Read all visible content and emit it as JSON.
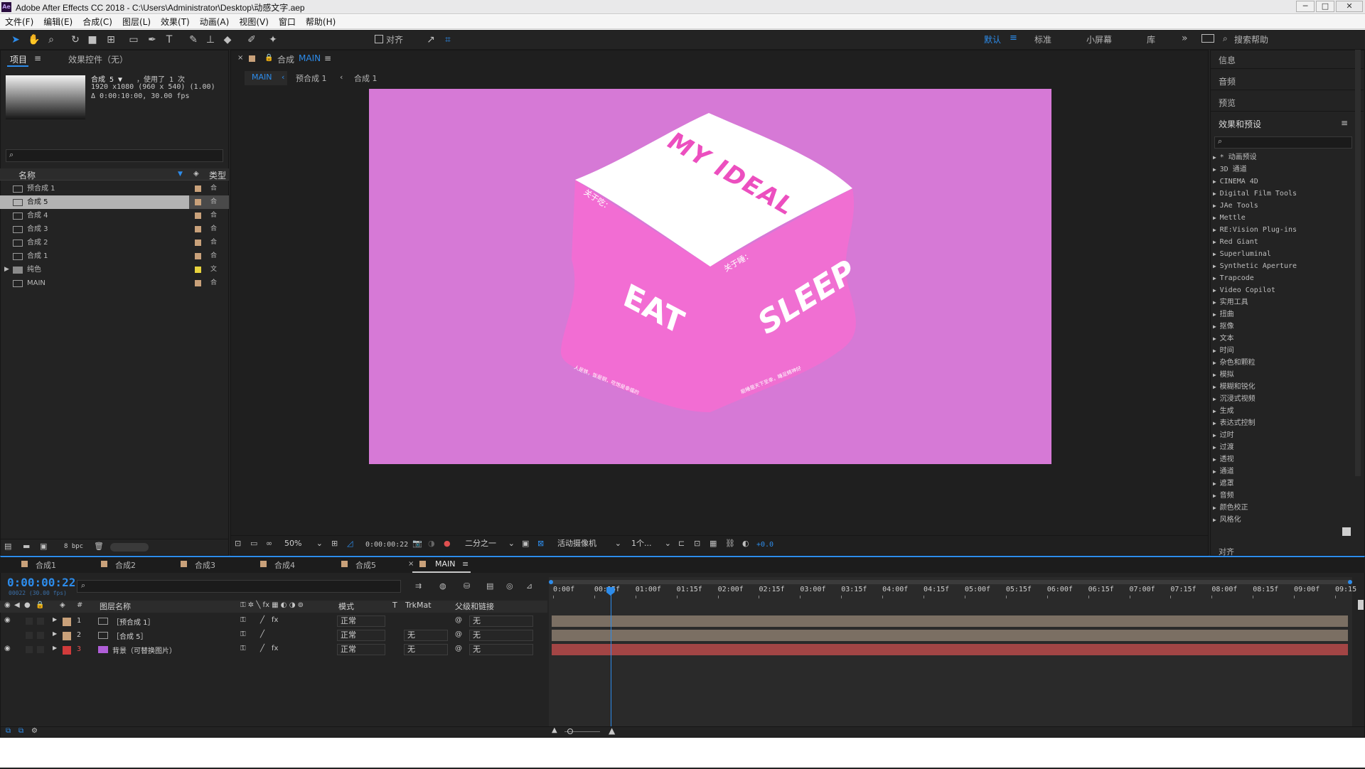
{
  "titlebar": {
    "logo": "Ae",
    "title": "Adobe After Effects CC 2018 - C:\\Users\\Administrator\\Desktop\\动感文字.aep",
    "min": "─",
    "max": "□",
    "close": "✕"
  },
  "menu": [
    "文件(F)",
    "编辑(E)",
    "合成(C)",
    "图层(L)",
    "效果(T)",
    "动画(A)",
    "视图(V)",
    "窗口",
    "帮助(H)"
  ],
  "toolbar": {
    "align_label": "对齐",
    "workspaces": [
      "默认",
      "标准",
      "小屏幕",
      "库"
    ],
    "more": "»",
    "search_placeholder": "搜索帮助"
  },
  "project": {
    "tab_project": "项目",
    "tab_effects": "效果控件（无）",
    "preview_name": "合成 5 ▼",
    "preview_used": "，使用了 1 次",
    "preview_size": "1920 x1080 (960 x 540) (1.00)",
    "preview_duration": "Δ 0:00:10:00, 30.00 fps",
    "col_name": "名称",
    "col_type": "类型",
    "items": [
      {
        "name": "预合成 1",
        "color": "#c9a17a",
        "type": "合"
      },
      {
        "name": "合成 5",
        "color": "#c9a17a",
        "type": "合"
      },
      {
        "name": "合成 4",
        "color": "#c9a17a",
        "type": "合"
      },
      {
        "name": "合成 3",
        "color": "#c9a17a",
        "type": "合"
      },
      {
        "name": "合成 2",
        "color": "#c9a17a",
        "type": "合"
      },
      {
        "name": "合成 1",
        "color": "#c9a17a",
        "type": "合"
      },
      {
        "name": "纯色",
        "color": "#e8d33d",
        "type": "文"
      },
      {
        "name": "MAIN",
        "color": "#c9a17a",
        "type": "合"
      }
    ],
    "bpc": "8 bpc"
  },
  "comp": {
    "tab_label": "合成",
    "tab_name": "MAIN",
    "crumbs": [
      "MAIN",
      "预合成 1",
      "合成 1"
    ],
    "crumb_sep": "‹",
    "cube_top": "MY IDEAL",
    "cube_left_small": "关于吃：",
    "cube_right_small": "关于睡：",
    "cube_left_big": "EAT",
    "cube_right_big": "SLEEP",
    "cube_left_note": "人是铁，饭是钢，吃饱是幸福的",
    "cube_right_note": "能睡是天下至幸，睡足精神好",
    "zoom": "50%",
    "timecode": "0:00:00:22",
    "resolution": "二分之一",
    "camera": "活动摄像机",
    "views": "1个...",
    "exposure": "+0.0",
    "bg_color": "#d679d6",
    "cube_color": "#f270d5"
  },
  "right": {
    "info": "信息",
    "audio": "音频",
    "preview": "预览",
    "effects_title": "效果和预设",
    "align_label": "对齐",
    "effects": [
      "* 动画预设",
      "3D 通道",
      "CINEMA 4D",
      "Digital Film Tools",
      "JAe Tools",
      "Mettle",
      "RE:Vision Plug-ins",
      "Red Giant",
      "Superluminal",
      "Synthetic Aperture",
      "Trapcode",
      "Video Copilot",
      "实用工具",
      "扭曲",
      "抠像",
      "文本",
      "时间",
      "杂色和颗粒",
      "模拟",
      "模糊和锐化",
      "沉浸式视频",
      "生成",
      "表达式控制",
      "过时",
      "过渡",
      "透视",
      "通道",
      "遮罩",
      "音频",
      "颜色校正",
      "风格化"
    ]
  },
  "timeline": {
    "tabs": [
      "合成1",
      "合成2",
      "合成3",
      "合成4",
      "合成5",
      "MAIN"
    ],
    "timecode": "0:00:00:22",
    "timecode_sub": "00022 (30.00 fps)",
    "col_layer": "图层名称",
    "col_mode": "模式",
    "col_t": "T",
    "col_trk": "TrkMat",
    "col_parent": "父级和链接",
    "layers": [
      {
        "num": "1",
        "name": "［预合成 1］",
        "color": "#c9a17a",
        "mode": "正常",
        "trk": "",
        "parent": "无"
      },
      {
        "num": "2",
        "name": "［合成 5］",
        "color": "#c9a17a",
        "mode": "正常",
        "trk": "无",
        "parent": "无"
      },
      {
        "num": "3",
        "name": "背景（可替换图片）",
        "color": "#d13b3b",
        "mode": "正常",
        "trk": "无",
        "parent": "无"
      }
    ],
    "ruler": [
      "0:00f",
      "00:15f",
      "01:00f",
      "01:15f",
      "02:00f",
      "02:15f",
      "03:00f",
      "03:15f",
      "04:00f",
      "04:15f",
      "05:00f",
      "05:15f",
      "06:00f",
      "06:15f",
      "07:00f",
      "07:15f",
      "08:00f",
      "08:15f",
      "09:00f",
      "09:15"
    ],
    "playhead_fraction": 0.0733,
    "bar_colors": [
      "#7b6f63",
      "#7b6f63",
      "#a34545"
    ]
  }
}
